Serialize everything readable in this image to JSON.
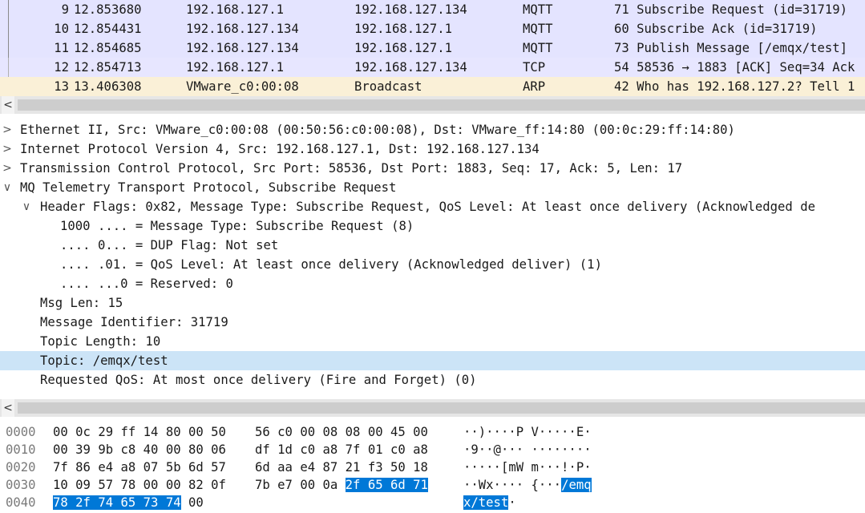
{
  "packets": [
    {
      "no": "9",
      "time": "12.853680",
      "src": "192.168.127.1",
      "dst": "192.168.127.134",
      "proto": "MQTT",
      "info": "71 Subscribe Request (id=31719)",
      "bg": "#e4e4ff"
    },
    {
      "no": "10",
      "time": "12.854431",
      "src": "192.168.127.134",
      "dst": "192.168.127.1",
      "proto": "MQTT",
      "info": "60 Subscribe Ack (id=31719)",
      "bg": "#e4e4ff"
    },
    {
      "no": "11",
      "time": "12.854685",
      "src": "192.168.127.134",
      "dst": "192.168.127.1",
      "proto": "MQTT",
      "info": "73 Publish Message [/emqx/test]",
      "bg": "#e4e4ff"
    },
    {
      "no": "12",
      "time": "12.854713",
      "src": "192.168.127.1",
      "dst": "192.168.127.134",
      "proto": "TCP",
      "info": "54 58536 → 1883 [ACK] Seq=34 Ack",
      "bg": "#e7e6ff"
    },
    {
      "no": "13",
      "time": "13.406308",
      "src": "VMware_c0:00:08",
      "dst": "Broadcast",
      "proto": "ARP",
      "info": "42 Who has 192.168.127.2? Tell 1",
      "bg": "#faf0d7"
    }
  ],
  "scroll_arrow": "<",
  "details": [
    {
      "toggle": ">",
      "text": "Ethernet II, Src: VMware_c0:00:08 (00:50:56:c0:00:08), Dst: VMware_ff:14:80 (00:0c:29:ff:14:80)",
      "level": 0
    },
    {
      "toggle": ">",
      "text": "Internet Protocol Version 4, Src: 192.168.127.1, Dst: 192.168.127.134",
      "level": 0
    },
    {
      "toggle": ">",
      "text": "Transmission Control Protocol, Src Port: 58536, Dst Port: 1883, Seq: 17, Ack: 5, Len: 17",
      "level": 0
    },
    {
      "toggle": "∨",
      "text": "MQ Telemetry Transport Protocol, Subscribe Request",
      "level": 0
    },
    {
      "toggle": "∨",
      "text": "Header Flags: 0x82, Message Type: Subscribe Request, QoS Level: At least once delivery (Acknowledged de",
      "level": 1
    },
    {
      "toggle": "",
      "text": "1000 .... = Message Type: Subscribe Request (8)",
      "level": 2
    },
    {
      "toggle": "",
      "text": ".... 0... = DUP Flag: Not set",
      "level": 2
    },
    {
      "toggle": "",
      "text": ".... .01. = QoS Level: At least once delivery (Acknowledged deliver) (1)",
      "level": 2
    },
    {
      "toggle": "",
      "text": ".... ...0 = Reserved: 0",
      "level": 2
    },
    {
      "toggle": "",
      "text": "Msg Len: 15",
      "level": 1
    },
    {
      "toggle": "",
      "text": "Message Identifier: 31719",
      "level": 1
    },
    {
      "toggle": "",
      "text": "Topic Length: 10",
      "level": 1
    },
    {
      "toggle": "",
      "text": "Topic: /emqx/test",
      "level": 1,
      "selected": true
    },
    {
      "toggle": "",
      "text": "Requested QoS: At most once delivery (Fire and Forget) (0)",
      "level": 1
    }
  ],
  "hex": [
    {
      "offset": "0000",
      "h1": "00 0c 29 ff 14 80 00 50",
      "h2": "56 c0 00 08 08 00 45 00",
      "asc": "··)····P V·····E·"
    },
    {
      "offset": "0010",
      "h1": "00 39 9b c8 40 00 80 06",
      "h2": "df 1d c0 a8 7f 01 c0 a8",
      "asc": "·9··@··· ········"
    },
    {
      "offset": "0020",
      "h1": "7f 86 e4 a8 07 5b 6d 57",
      "h2": "6d aa e4 87 21 f3 50 18",
      "asc": "·····[mW m···!·P·"
    },
    {
      "offset": "0030",
      "h1": "10 09 57 78 00 00 82 0f",
      "h2_pre": "7b e7 00 0a ",
      "h2_hl": "2f 65 6d 71",
      "asc_pre": "··Wx···· {···",
      "asc_hl": "/emq"
    },
    {
      "offset": "0040",
      "h1_hl": "78 2f 74 65 73 74",
      "h1_post": " 00",
      "asc_hl": "x/test",
      "asc_post": "·"
    }
  ]
}
